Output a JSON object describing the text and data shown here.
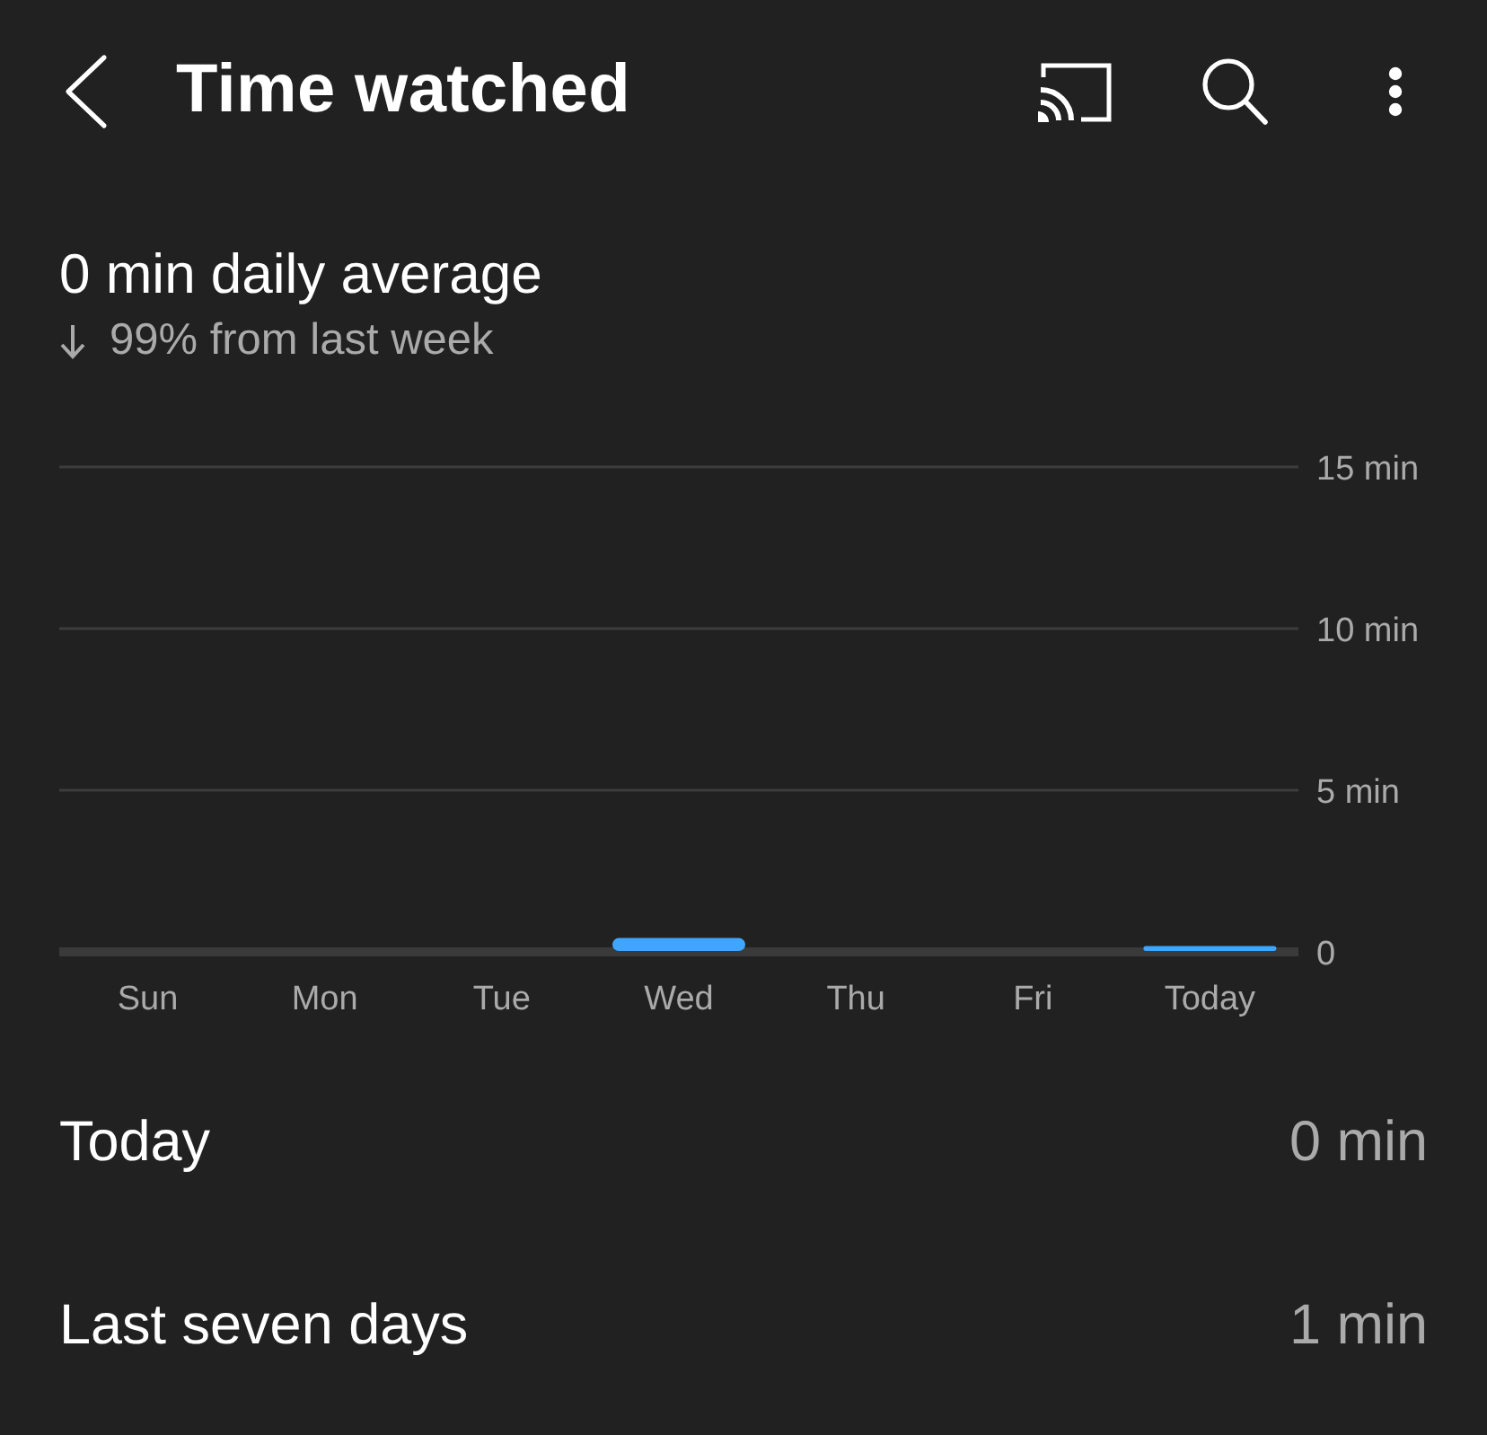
{
  "header": {
    "title": "Time watched"
  },
  "summary": {
    "headline": "0 min daily average",
    "change": "99% from last week",
    "decrease": true
  },
  "chart": {
    "chart_data": {
      "type": "bar",
      "categories": [
        "Sun",
        "Mon",
        "Tue",
        "Wed",
        "Thu",
        "Fri",
        "Today"
      ],
      "series": [
        {
          "color": "#3ea6ff",
          "values": [
            0,
            0,
            0,
            0.4,
            0,
            0,
            0.15
          ]
        }
      ],
      "ylim": [
        0,
        15
      ],
      "yticks": [
        {
          "value": 0,
          "label": "0"
        },
        {
          "value": 5,
          "label": "5 min"
        },
        {
          "value": 10,
          "label": "10 min"
        },
        {
          "value": 15,
          "label": "15 min"
        }
      ]
    }
  },
  "stats": [
    {
      "label": "Today",
      "value": "0 min"
    },
    {
      "label": "Last seven days",
      "value": "1 min"
    }
  ]
}
